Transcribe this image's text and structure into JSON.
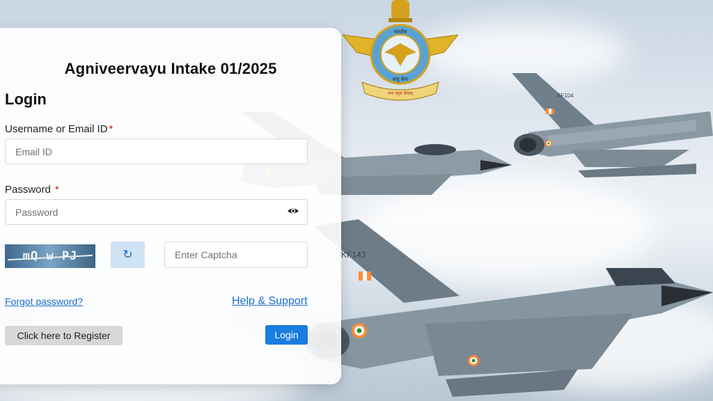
{
  "page": {
    "title": "Agniveervayu Intake 01/2025"
  },
  "login_form": {
    "heading": "Login",
    "username": {
      "label": "Username or Email ID",
      "required_mark": "*",
      "placeholder": "Email ID",
      "value": ""
    },
    "password": {
      "label": "Password",
      "required_mark": "*",
      "placeholder": "Password",
      "value": ""
    },
    "captcha": {
      "image_text": "mQ w PJ",
      "placeholder": "Enter Captcha",
      "value": ""
    },
    "links": {
      "forgot_password": "Forgot password?",
      "help_support": "Help & Support"
    },
    "buttons": {
      "register": "Click here to Register",
      "login": "Login"
    }
  },
  "icons": {
    "password_visibility": "eye-icon",
    "captcha_refresh": "refresh-icon",
    "logo": "indian-air-force-emblem"
  },
  "colors": {
    "primary_button": "#1a7de0",
    "link": "#1a6fd1",
    "required": "#e01010",
    "refresh_button_bg": "#cfe3f5"
  },
  "emblem": {
    "text_top": "भारतीय",
    "text_bottom": "नभः स्पृशं दीप्तम्",
    "text_ring": "वायु सेना"
  },
  "aircraft_markings": {
    "jet_1": "KF104",
    "jet_2": "KF143"
  }
}
